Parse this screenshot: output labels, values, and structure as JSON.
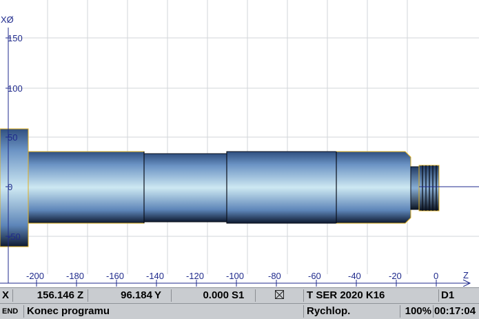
{
  "simulation": {
    "x_axis_label": "XØ",
    "z_axis_label": "Z",
    "x_ticks": [
      "150",
      "100",
      "50",
      "0",
      "-50"
    ],
    "z_ticks": [
      "-200",
      "-180",
      "-160",
      "-140",
      "-120",
      "-100",
      "-80",
      "-60",
      "-40",
      "-20",
      "0"
    ],
    "axis_color": "#1f2a8c",
    "grid_color": "#d2d5da",
    "part_color": "#5f86b8",
    "outline_color": "#e0b020"
  },
  "status": {
    "x_label": "X",
    "x_value": "156.146",
    "z_label": "Z",
    "z_value": "96.184",
    "y_label": "Y",
    "y_value": "0.000",
    "s_label": "S1",
    "tool": "T SER 2020 K16",
    "d_label": "D1",
    "end_label": "END",
    "program_status": "Konec programu",
    "feed_mode": "Rychlop.",
    "override": "100%",
    "time": "00:17:04"
  }
}
